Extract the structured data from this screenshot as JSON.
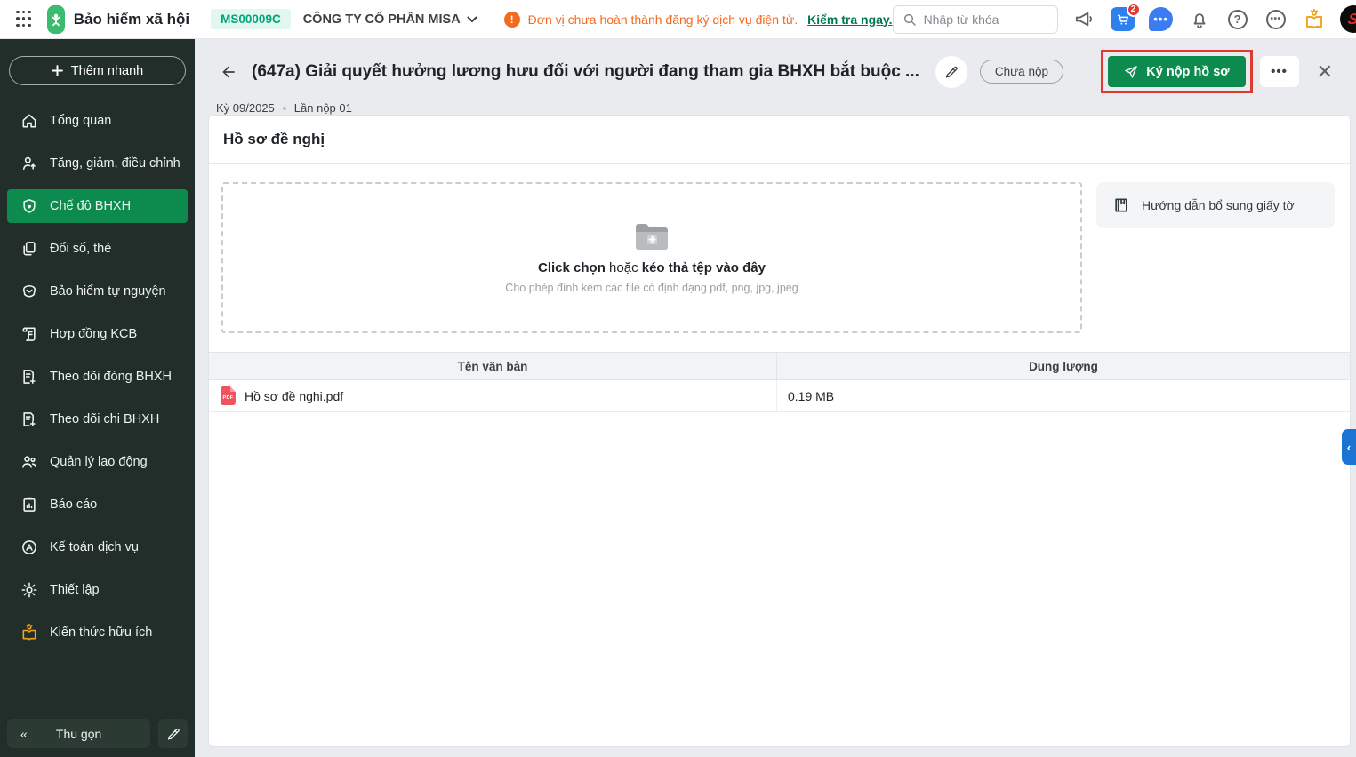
{
  "colors": {
    "green": "#0d8a4e",
    "logo-green": "#3cbb6e",
    "sidebar-bg": "#212e2a",
    "warning-orange": "#f26a1f",
    "link-green": "#00794d",
    "annotation-red": "#e0392f",
    "panel-blue": "#1b74d4"
  },
  "header": {
    "app_title": "Bảo hiểm xã hội",
    "company_code": "MS00009C",
    "company_name": "CÔNG TY CỔ PHẦN MISA",
    "warning_text": "Đơn vị chưa hoàn thành đăng ký dịch vụ điện tử.",
    "warning_link": "Kiểm tra ngay.",
    "search_placeholder": "Nhập từ khóa",
    "cart_badge": "2",
    "avatar_letter": "S"
  },
  "sidebar": {
    "quick_add_label": "Thêm nhanh",
    "items": [
      {
        "label": "Tổng quan"
      },
      {
        "label": "Tăng, giảm, điều chỉnh"
      },
      {
        "label": "Chế độ BHXH",
        "active": true
      },
      {
        "label": "Đổi sổ, thẻ"
      },
      {
        "label": "Bảo hiểm tự nguyện"
      },
      {
        "label": "Hợp đồng KCB"
      },
      {
        "label": "Theo dõi đóng BHXH"
      },
      {
        "label": "Theo dõi chi BHXH"
      },
      {
        "label": "Quản lý lao động"
      },
      {
        "label": "Báo cáo"
      },
      {
        "label": "Kế toán dịch vụ"
      },
      {
        "label": "Thiết lập"
      },
      {
        "label": "Kiến thức hữu ích"
      }
    ],
    "collapse_label": "Thu gọn"
  },
  "page": {
    "title": "(647a) Giải quyết hưởng lương hưu đối với người đang tham gia BHXH bắt buộc ...",
    "status_badge": "Chưa nộp",
    "period": "Kỳ 09/2025",
    "submission": "Lần nộp 01",
    "submit_button": "Ký nộp hồ sơ",
    "more_button": "•••",
    "close_glyph": "✕"
  },
  "card": {
    "title": "Hồ sơ đề nghị",
    "dropzone": {
      "bold1": "Click chọn",
      "mid": "hoặc",
      "bold2": "kéo thả tệp vào đây",
      "hint": "Cho phép đính kèm các file có định dạng pdf, png, jpg, jpeg"
    },
    "guide_button": "Hướng dẫn bổ sung giấy tờ",
    "table": {
      "col_name": "Tên văn bản",
      "col_size": "Dung lượng",
      "rows": [
        {
          "name": "Hồ sơ đề nghị.pdf",
          "size": "0.19 MB",
          "file_type": "PDF"
        }
      ]
    }
  }
}
